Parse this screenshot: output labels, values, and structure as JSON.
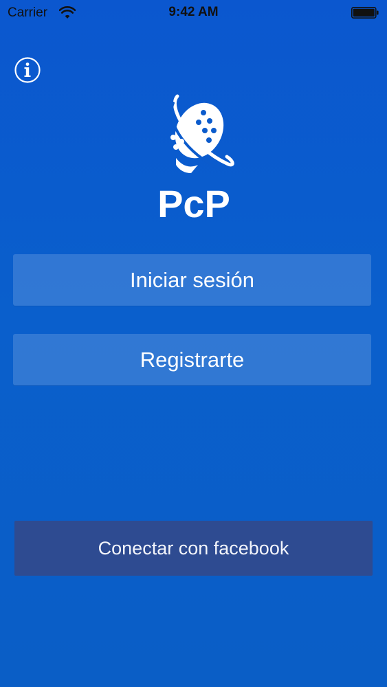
{
  "status_bar": {
    "carrier": "Carrier",
    "time": "9:42 AM",
    "wifi_icon": "wifi-icon",
    "battery_icon": "battery-icon"
  },
  "header": {
    "info_icon": "info-icon"
  },
  "logo": {
    "icon": "padel-racket-logo-icon",
    "wordmark": "PcP"
  },
  "actions": {
    "login_label": "Iniciar sesión",
    "register_label": "Registrarte",
    "facebook_label": "Conectar con facebook"
  },
  "colors": {
    "background": "#0b5bcc",
    "button_overlay": "#ffffff29",
    "facebook": "#2e4b91",
    "text": "#ffffff"
  }
}
